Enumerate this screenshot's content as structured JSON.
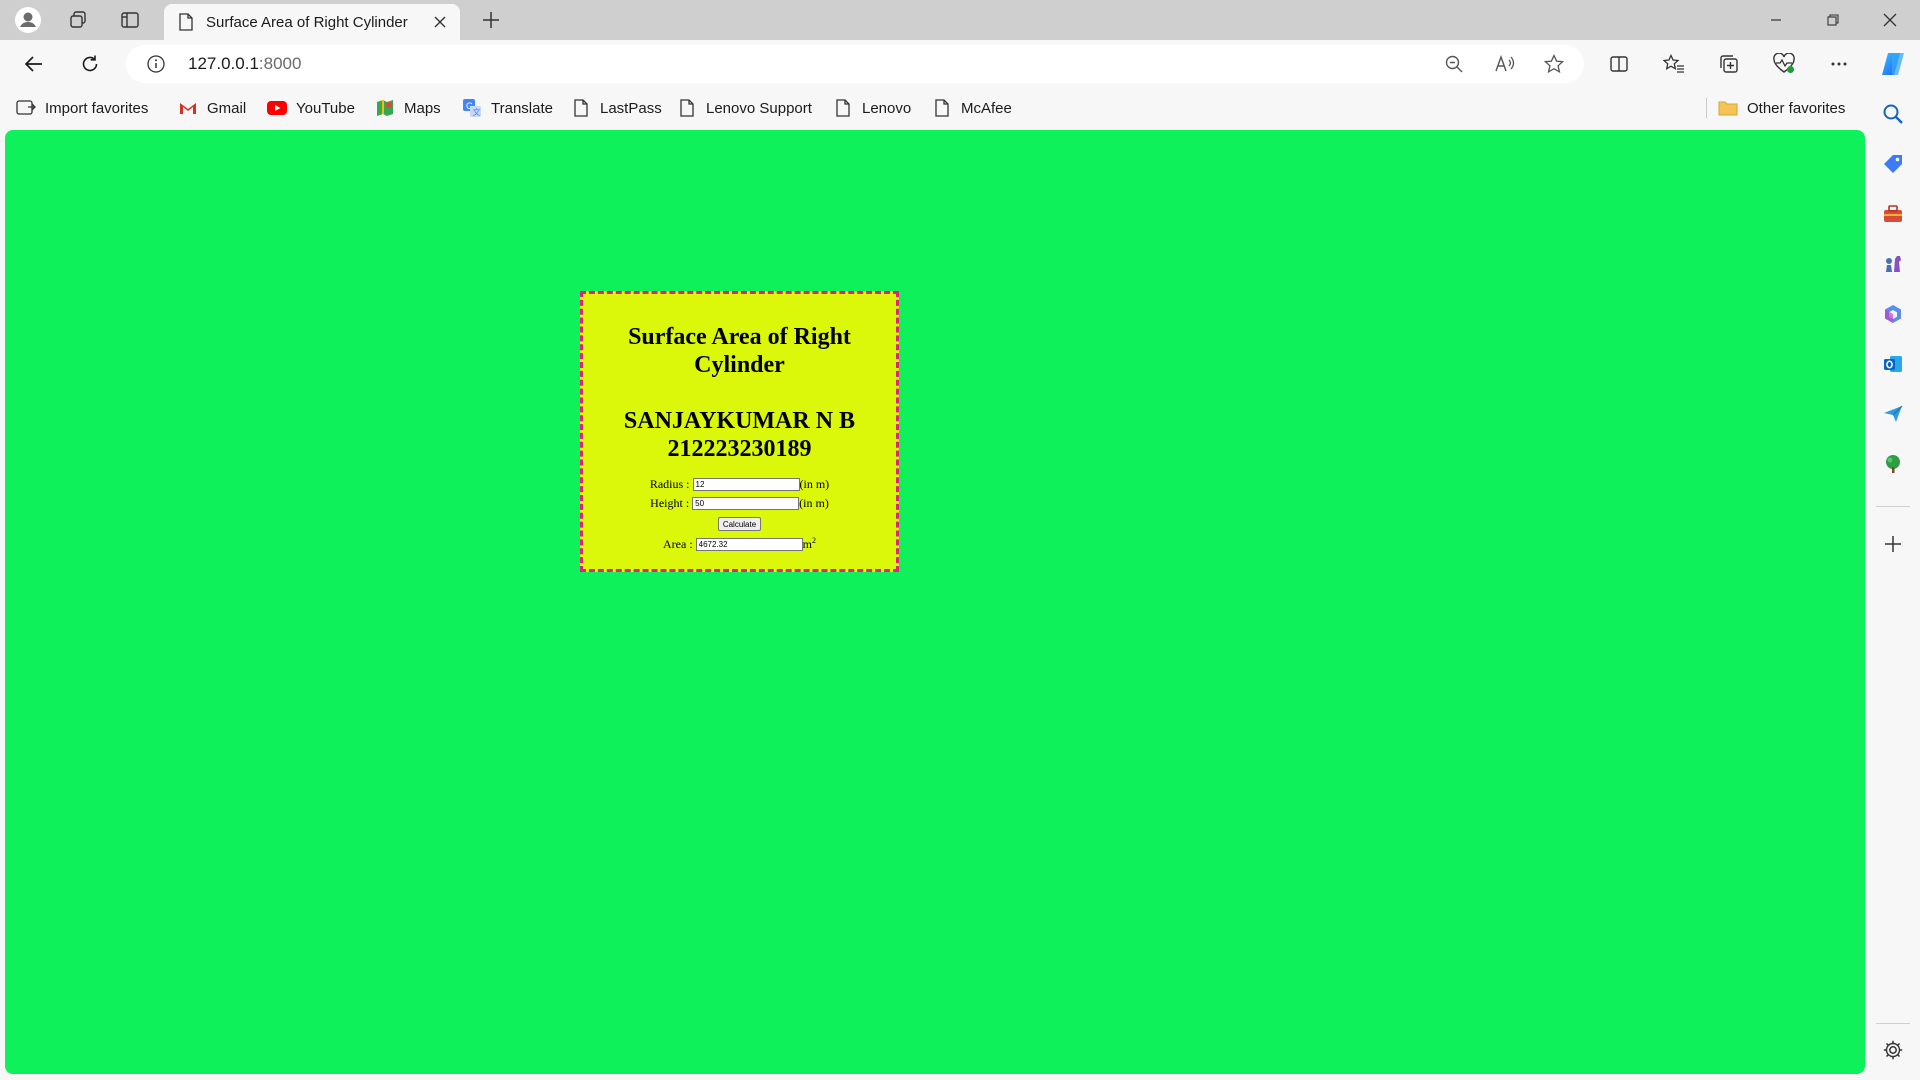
{
  "browser": {
    "tab": {
      "title": "Surface Area of Right Cylinder"
    },
    "address": {
      "host": "127.0.0.1",
      "port": ":8000"
    },
    "favorites": [
      {
        "label": "Import favorites",
        "icon": "import-favorites-icon"
      },
      {
        "label": "Gmail",
        "icon": "gmail-icon"
      },
      {
        "label": "YouTube",
        "icon": "youtube-icon"
      },
      {
        "label": "Maps",
        "icon": "maps-icon"
      },
      {
        "label": "Translate",
        "icon": "translate-icon"
      },
      {
        "label": "LastPass",
        "icon": "page-icon"
      },
      {
        "label": "Lenovo Support",
        "icon": "page-icon"
      },
      {
        "label": "Lenovo",
        "icon": "page-icon"
      },
      {
        "label": "McAfee",
        "icon": "page-icon"
      }
    ],
    "other_favorites": "Other favorites"
  },
  "page": {
    "background": "#0ef15a",
    "card_background": "#dbf70a",
    "card_border": "#e0237c",
    "title": "Surface Area of Right Cylinder",
    "name": "SANJAYKUMAR N B",
    "reg_no": "212223230189",
    "form": {
      "radius_label": "Radius :",
      "radius_value": "12",
      "height_label": "Height :",
      "height_value": "50",
      "unit": "(in m)",
      "calculate_label": "Calculate",
      "area_label": "Area :",
      "area_value": "4672.32",
      "area_unit": "m",
      "area_unit_exp": "2"
    }
  }
}
